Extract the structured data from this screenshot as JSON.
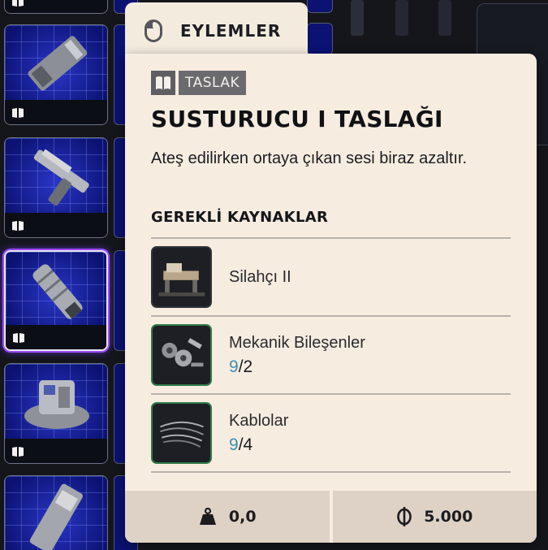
{
  "actions_tab": {
    "title": "EYLEMLER",
    "icon": "mouse-icon"
  },
  "item": {
    "tag": "TASLAK",
    "title": "SUSTURUCU I TASLAĞI",
    "description": "Ateş edilirken ortaya çıkan sesi biraz azaltır.",
    "requirements_heading": "GEREKLİ KAYNAKLAR",
    "requirements": [
      {
        "name": "Silahçı II",
        "qty_have": "",
        "qty_sep": "",
        "qty_need": "",
        "icon": "workbench-icon"
      },
      {
        "name": "Mekanik Bileşenler",
        "qty_have": "9",
        "qty_sep": "/",
        "qty_need": "2",
        "icon": "mechanical-parts-icon"
      },
      {
        "name": "Kablolar",
        "qty_have": "9",
        "qty_sep": "/",
        "qty_need": "4",
        "icon": "wires-icon"
      }
    ],
    "weight": "0,0",
    "price": "5.000"
  },
  "colors": {
    "panel": "#f7ece0",
    "footer": "#ddd2c5",
    "tag": "#6b6b6f",
    "qty_have": "#3c8fae",
    "slot_bg": "#0a1170",
    "selected_glow": "#9b4dff"
  }
}
